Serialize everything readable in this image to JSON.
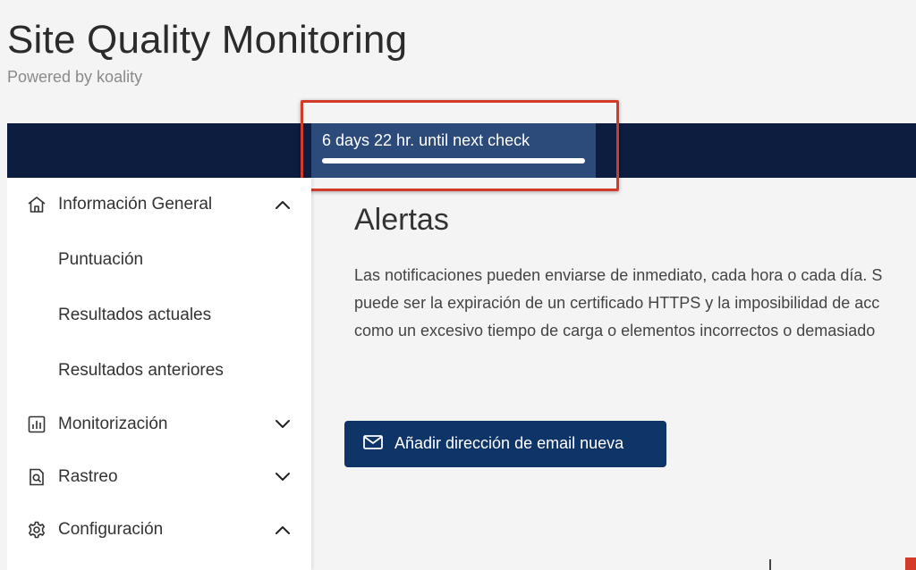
{
  "header": {
    "title": "Site Quality Monitoring",
    "subtitle": "Powered by koality"
  },
  "next_check": {
    "label": "6 days 22 hr. until next check",
    "progress_percent": 100
  },
  "colors": {
    "topbar": "#0c1d3f",
    "check_box": "#2c4a7a",
    "highlight": "#d23a2a",
    "button": "#0f3468"
  },
  "sidebar": {
    "items": [
      {
        "label": "Información General",
        "icon": "home-icon",
        "chevron": "chevron-up-icon"
      },
      {
        "label": "Puntuación"
      },
      {
        "label": "Resultados actuales"
      },
      {
        "label": "Resultados anteriores"
      },
      {
        "label": "Monitorización",
        "icon": "bar-chart-icon",
        "chevron": "chevron-down-icon"
      },
      {
        "label": "Rastreo",
        "icon": "document-search-icon",
        "chevron": "chevron-down-icon"
      },
      {
        "label": "Configuración",
        "icon": "gear-icon",
        "chevron": "chevron-up-icon"
      }
    ]
  },
  "main": {
    "title": "Alertas",
    "paragraph_lines": [
      "Las notificaciones pueden enviarse de inmediato, cada hora o cada día. S",
      "puede ser la expiración de un certificado HTTPS y la imposibilidad de acc",
      "como un excesivo tiempo de carga o elementos incorrectos o demasiado"
    ],
    "add_email_button": "Añadir dirección de email nueva"
  }
}
